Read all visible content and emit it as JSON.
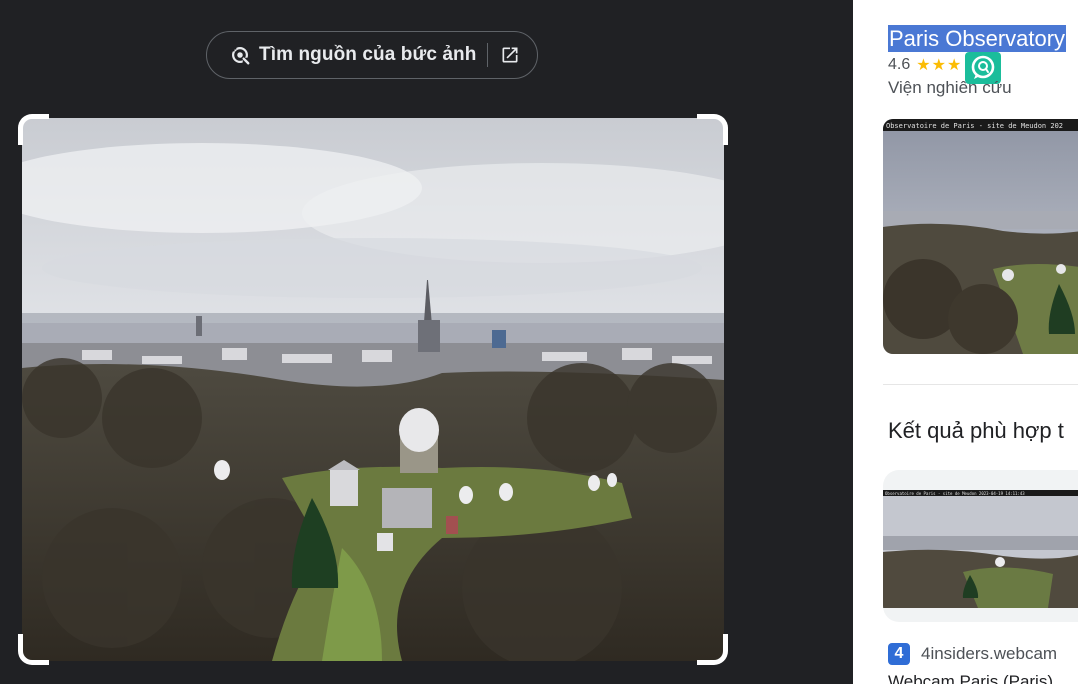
{
  "find_source": {
    "label": "Tìm nguồn của bức ảnh",
    "lens_icon": "lens-search-icon",
    "open_icon": "open-in-new-icon"
  },
  "knowledge_panel": {
    "title": "Paris Observatory",
    "rating": "4.6",
    "stars": "★★★",
    "type": "Viện nghiên cứu",
    "thumb_caption": "Observatoire de Paris - site de Meudon 202"
  },
  "matches": {
    "section_title": "Kết quả phù hợp t",
    "card_caption": "Observatoire de Paris - site de Meudon 2023-04-19 14:11:43",
    "source": "4insiders.webcam",
    "source_favicon": "4",
    "title": "Webcam Paris (Paris)"
  },
  "colors": {
    "dark_bg": "#202124",
    "highlight": "#4a78d4",
    "star": "#fbbc04",
    "extension": "#1bbd9b"
  }
}
